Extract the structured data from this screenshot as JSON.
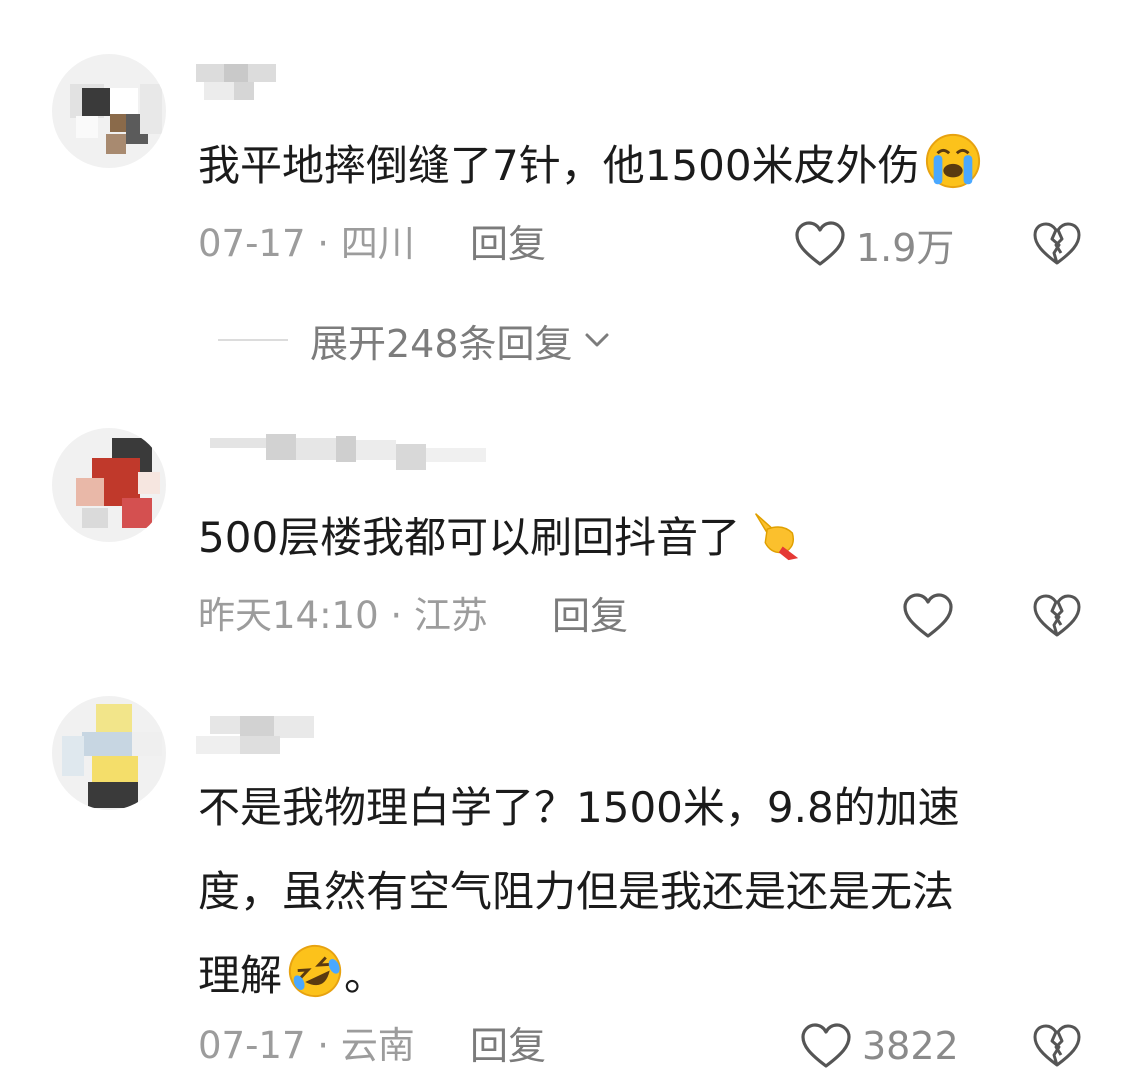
{
  "comments": [
    {
      "text": "我平地摔倒缝了7针，他1500米皮外伤",
      "emoji": "loudly-crying-face",
      "time": "07-17",
      "location": "四川",
      "reply_label": "回复",
      "likes": "1.9万",
      "expand_label": "展开248条回复"
    },
    {
      "text": "500层楼我都可以刷回抖音了",
      "emoji": "pinching-hand",
      "time": "昨天14:10",
      "location": "江苏",
      "reply_label": "回复",
      "likes": ""
    },
    {
      "text_line1": "不是我物理白学了？1500米，9.8的加速",
      "text_line2": "度，虽然有空气阻力但是我还是还是无法",
      "text_line3_a": "理解",
      "text_line3_b": "。",
      "emoji": "rolling-on-the-floor-laughing",
      "time": "07-17",
      "location": "云南",
      "reply_label": "回复",
      "likes": "3822"
    }
  ],
  "meta_separator": " · ",
  "colors": {
    "text": "#1b1b1b",
    "meta": "#9c9c9c",
    "icon": "#555555"
  }
}
